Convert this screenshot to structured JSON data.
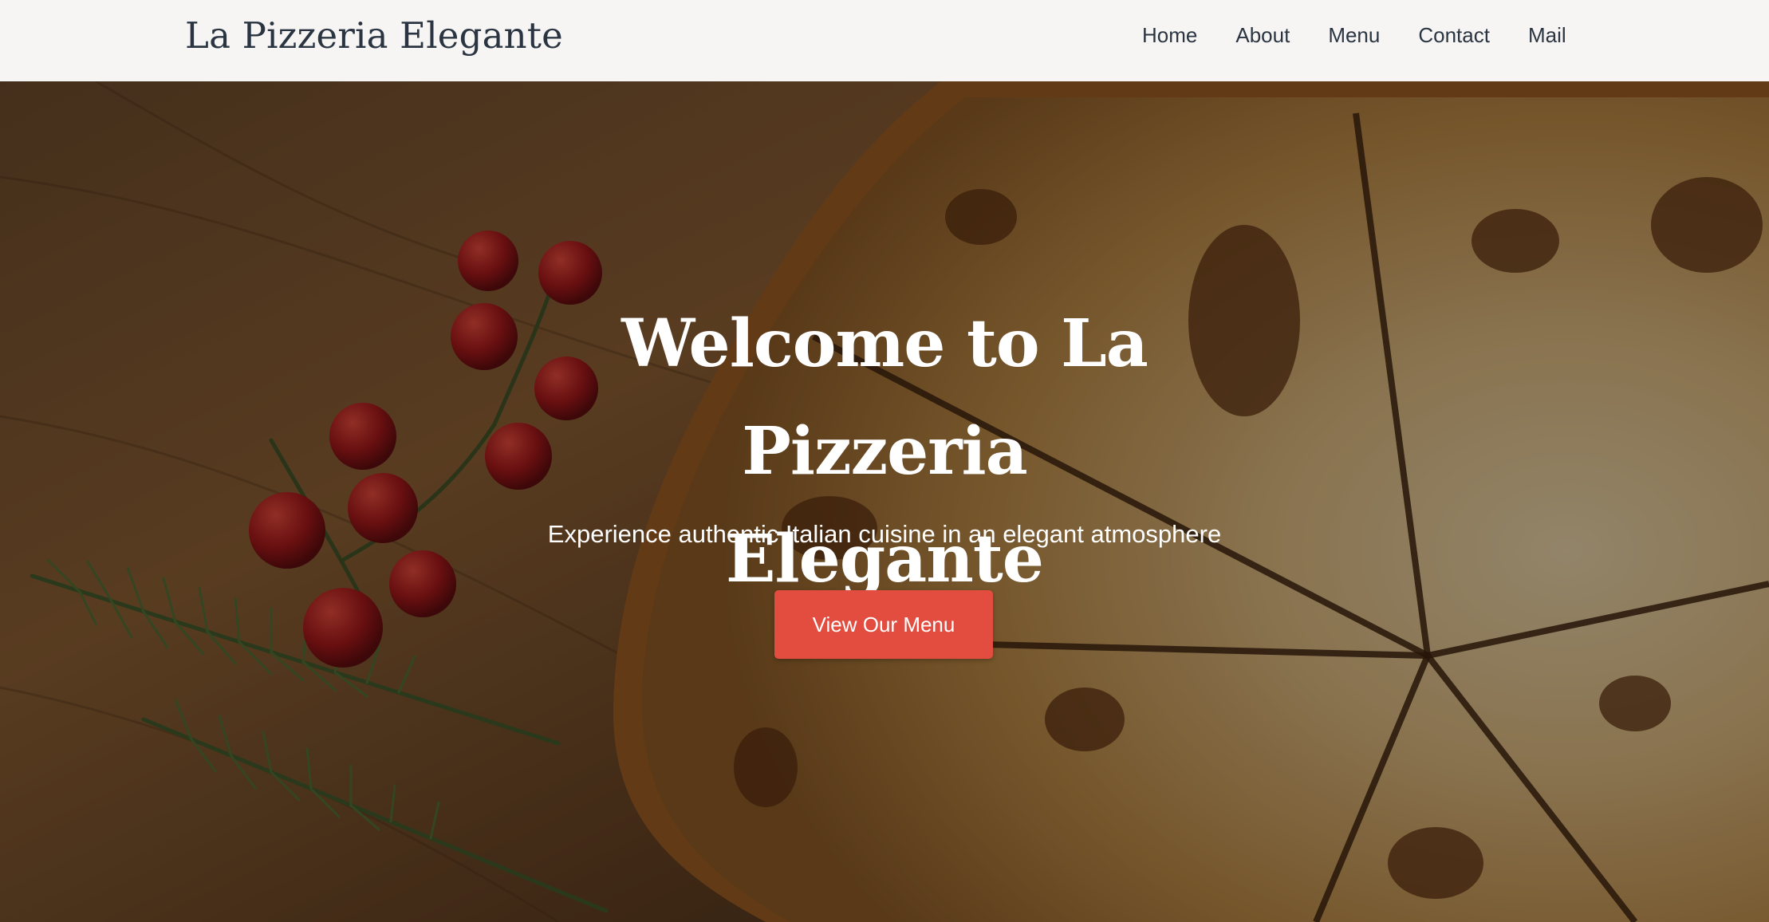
{
  "navbar": {
    "brand": "La Pizzeria Elegante",
    "links": [
      {
        "label": "Home"
      },
      {
        "label": "About"
      },
      {
        "label": "Menu"
      },
      {
        "label": "Contact"
      },
      {
        "label": "Mail"
      }
    ]
  },
  "hero": {
    "title_line1": "Welcome to La Pizzeria",
    "title_line2": "Elegante",
    "subtitle": "Experience authentic Italian cuisine in an elegant atmosphere",
    "cta_label": "View Our Menu",
    "background_image": "pizza-on-wooden-board-with-cherry-tomatoes-and-rosemary"
  },
  "colors": {
    "navbar_bg": "#f6f5f4",
    "nav_text": "#2b3542",
    "cta_bg": "#e24d3f",
    "hero_text": "#ffffff"
  }
}
